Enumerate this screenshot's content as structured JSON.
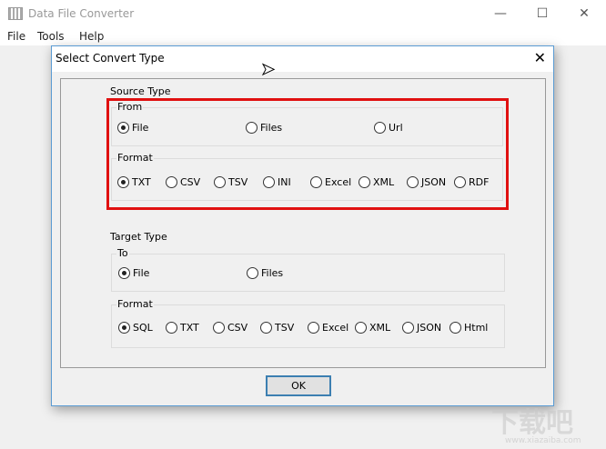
{
  "window": {
    "title": "Data File Converter",
    "minimize": "—",
    "maximize": "☐",
    "close": "✕"
  },
  "menu": [
    "File",
    "Tools",
    "Help"
  ],
  "dialog": {
    "title": "Select Convert Type",
    "close": "✕",
    "source": {
      "label": "Source Type",
      "from": {
        "label": "From",
        "options": [
          "File",
          "Files",
          "Url"
        ],
        "selected": "File"
      },
      "format": {
        "label": "Format",
        "options": [
          "TXT",
          "CSV",
          "TSV",
          "INI",
          "Excel",
          "XML",
          "JSON",
          "RDF"
        ],
        "selected": "TXT"
      }
    },
    "target": {
      "label": "Target Type",
      "to": {
        "label": "To",
        "options": [
          "File",
          "Files"
        ],
        "selected": "File"
      },
      "format": {
        "label": "Format",
        "options": [
          "SQL",
          "TXT",
          "CSV",
          "TSV",
          "Excel",
          "XML",
          "JSON",
          "Html"
        ],
        "selected": "SQL"
      }
    },
    "ok": "OK"
  },
  "watermark": {
    "text": "下载吧",
    "url": "www.xiazaiba.com"
  },
  "colors": {
    "highlight": "#e01010",
    "accent": "#3c7fb1"
  }
}
